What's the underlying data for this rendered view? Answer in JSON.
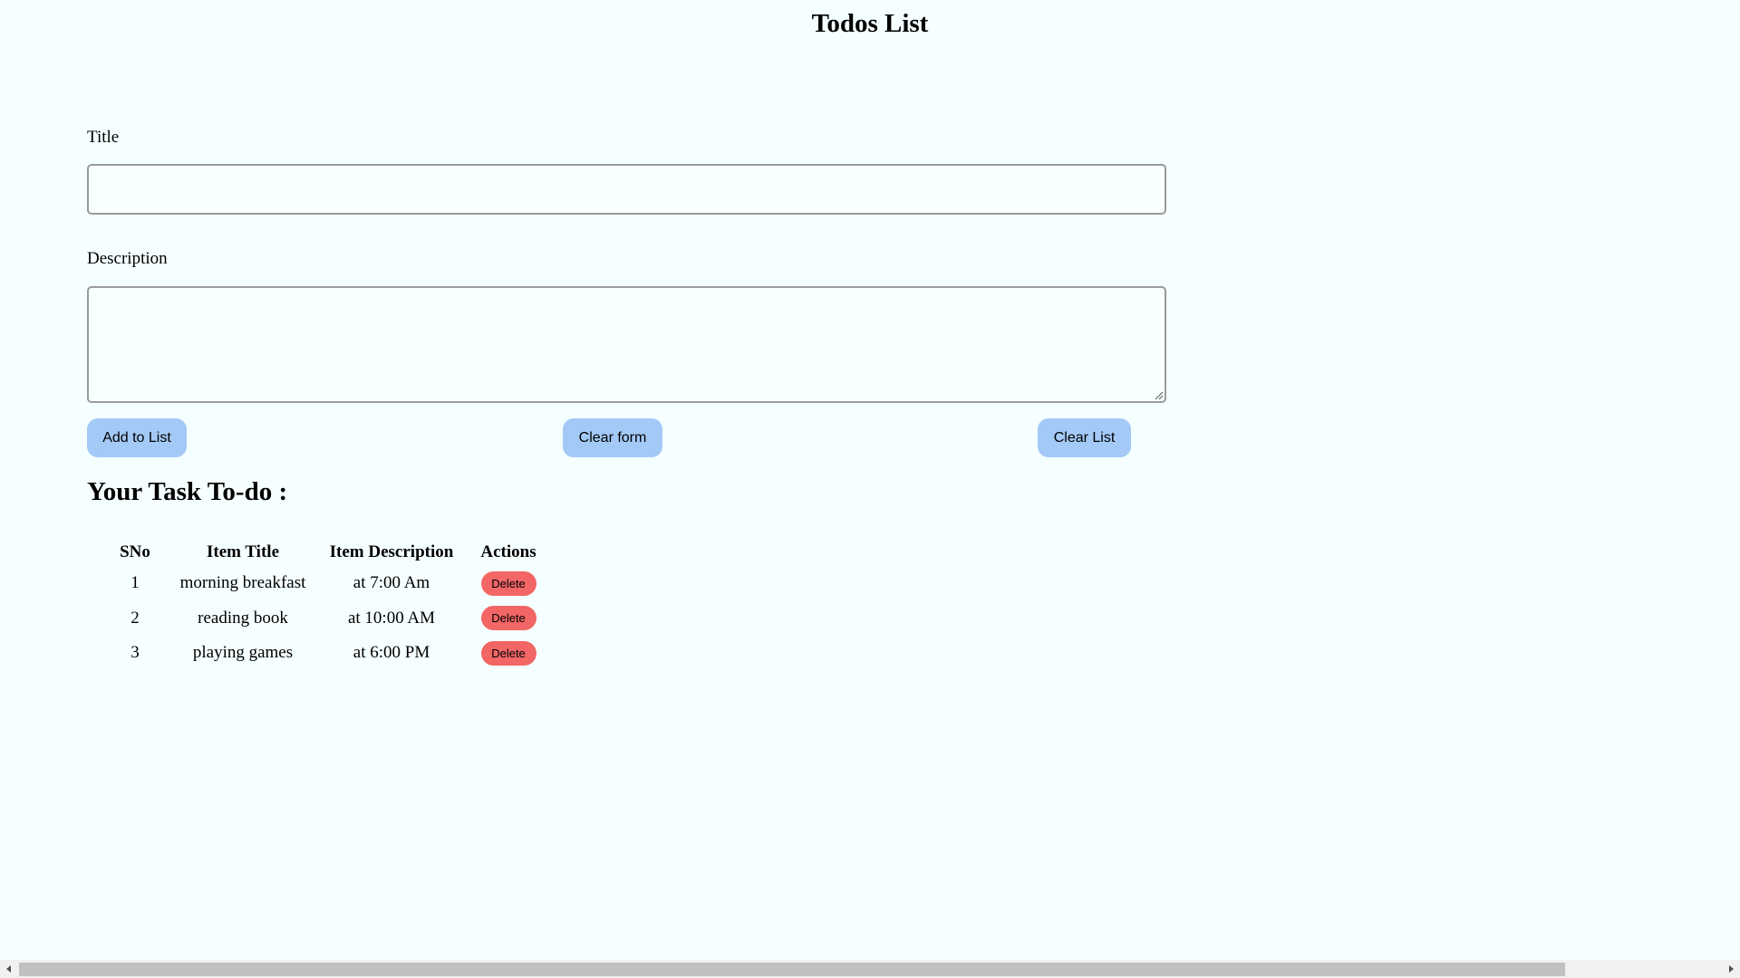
{
  "header": {
    "title": "Todos List"
  },
  "form": {
    "title_label": "Title",
    "title_value": "",
    "description_label": "Description",
    "description_value": "",
    "buttons": {
      "add": "Add to List",
      "clear_form": "Clear form",
      "clear_list": "Clear List"
    }
  },
  "tasks": {
    "heading": "Your Task To-do :",
    "columns": [
      "SNo",
      "Item Title",
      "Item Description",
      "Actions"
    ],
    "rows": [
      {
        "sno": "1",
        "title": "morning breakfast",
        "description": "at 7:00 Am",
        "action": "Delete"
      },
      {
        "sno": "2",
        "title": "reading book",
        "description": "at 10:00 AM",
        "action": "Delete"
      },
      {
        "sno": "3",
        "title": "playing games",
        "description": "at 6:00 PM",
        "action": "Delete"
      }
    ]
  },
  "colors": {
    "background": "#f5ffff",
    "primary_button": "#a3c9f7",
    "delete_button": "#f26666"
  },
  "icons": {
    "textarea_resize": "resize-grip-icon",
    "scroll_left": "chevron-left-icon",
    "scroll_right": "chevron-right-icon"
  }
}
